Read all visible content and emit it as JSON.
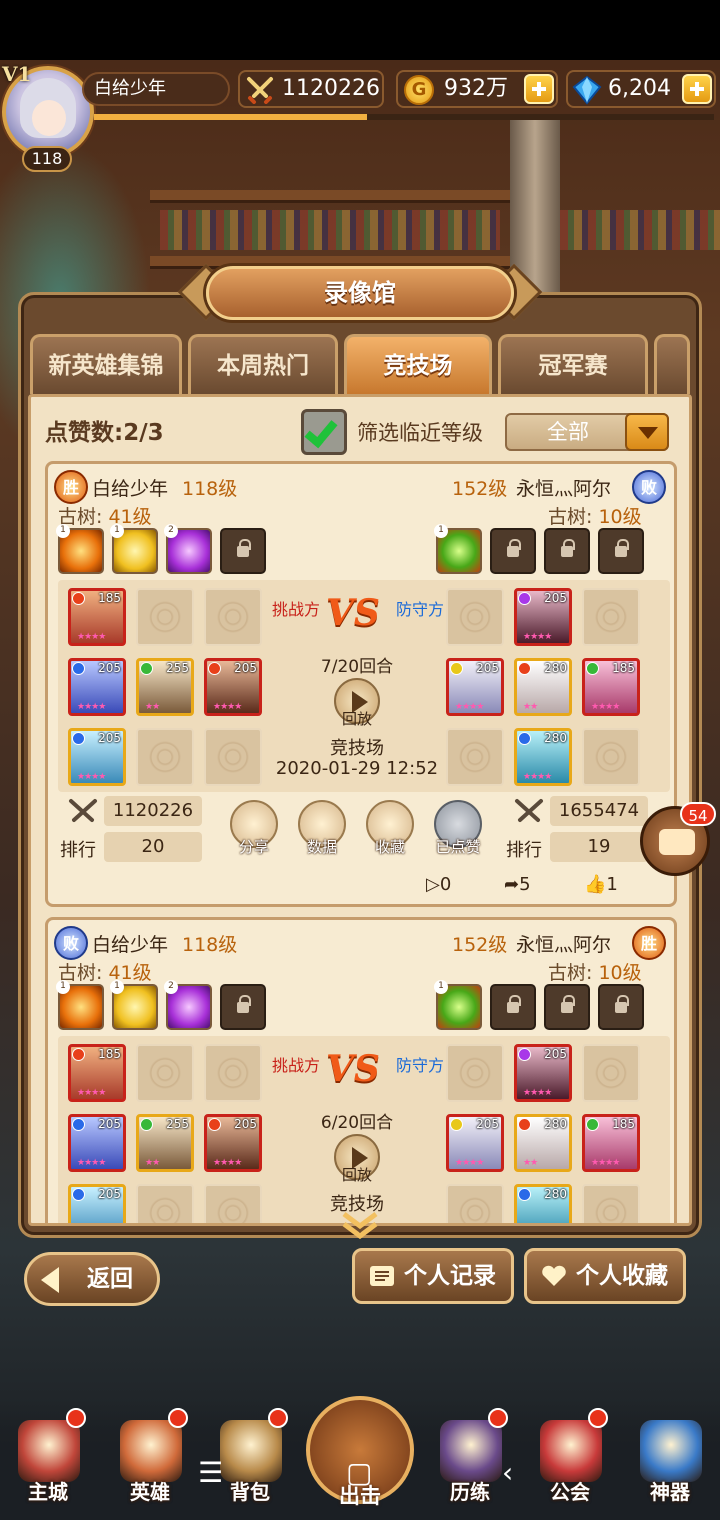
{
  "player": {
    "vip_label": "V1",
    "name": "白给少年",
    "level": "118",
    "power": "1120226",
    "gold": "932万",
    "gems": "6,204",
    "xp_fraction": 0.44
  },
  "panel": {
    "title": "录像馆",
    "tabs": [
      {
        "label": "新英雄集锦",
        "active": false
      },
      {
        "label": "本周热门",
        "active": false
      },
      {
        "label": "竞技场",
        "active": true
      },
      {
        "label": "冠军赛",
        "active": false
      }
    ],
    "likes_label": "点赞数:2/3",
    "filter_label": "筛选临近等级",
    "filter_checked": true,
    "select_value": "全部"
  },
  "replays": [
    {
      "left": {
        "result": "胜",
        "name": "白给少年",
        "level": "118级",
        "tree_label": "古树:",
        "tree_level": "41级"
      },
      "right": {
        "result": "败",
        "name": "永恒灬阿尔",
        "level": "152级",
        "tree_label": "古树:",
        "tree_level": "10级"
      },
      "challenger_label": "挑战方",
      "defender_label": "防守方",
      "rounds": "7/20回合",
      "play_label": "回放",
      "mode": "竞技场",
      "date": "2020-01-29 12:52",
      "left_power": "1120226",
      "right_power": "1655474",
      "rank_label": "排行",
      "left_rank": "20",
      "right_rank": "19",
      "actions": [
        "分享",
        "数据",
        "收藏",
        "已点赞"
      ],
      "plays": "0",
      "shares": "5",
      "likes": "1"
    },
    {
      "left": {
        "result": "败",
        "name": "白给少年",
        "level": "118级",
        "tree_label": "古树:",
        "tree_level": "41级"
      },
      "right": {
        "result": "胜",
        "name": "永恒灬阿尔",
        "level": "152级",
        "tree_label": "古树:",
        "tree_level": "10级"
      },
      "challenger_label": "挑战方",
      "defender_label": "防守方",
      "rounds": "6/20回合",
      "play_label": "回放",
      "mode": "竞技场"
    }
  ],
  "heroes": {
    "left": [
      [
        "185",
        "",
        ""
      ],
      [
        "205",
        "255",
        "205"
      ],
      [
        "205",
        "",
        ""
      ]
    ],
    "right": [
      [
        "",
        "205",
        ""
      ],
      [
        "205",
        "280",
        "185"
      ],
      [
        "",
        "280",
        ""
      ]
    ]
  },
  "relic_stars": {
    "left": [
      "1",
      "1",
      "2"
    ],
    "right": [
      "1"
    ]
  },
  "buttons": {
    "back": "返回",
    "records": "个人记录",
    "favorites": "个人收藏"
  },
  "chat_badge": "54",
  "nav": [
    {
      "label": "主城",
      "color": "#c0463a"
    },
    {
      "label": "英雄",
      "color": "#d06a3a"
    },
    {
      "label": "背包",
      "color": "#b88a4a"
    },
    {
      "label": "出击",
      "color": "#c87a3a"
    },
    {
      "label": "历练",
      "color": "#6a4a8a"
    },
    {
      "label": "公会",
      "color": "#c83a3a"
    },
    {
      "label": "神器",
      "color": "#3a7ac8"
    }
  ],
  "colors": {
    "accent": "#b8620c",
    "win": "#e05a10",
    "lose": "#4a6ad8",
    "hero_border": "#c8221a"
  }
}
